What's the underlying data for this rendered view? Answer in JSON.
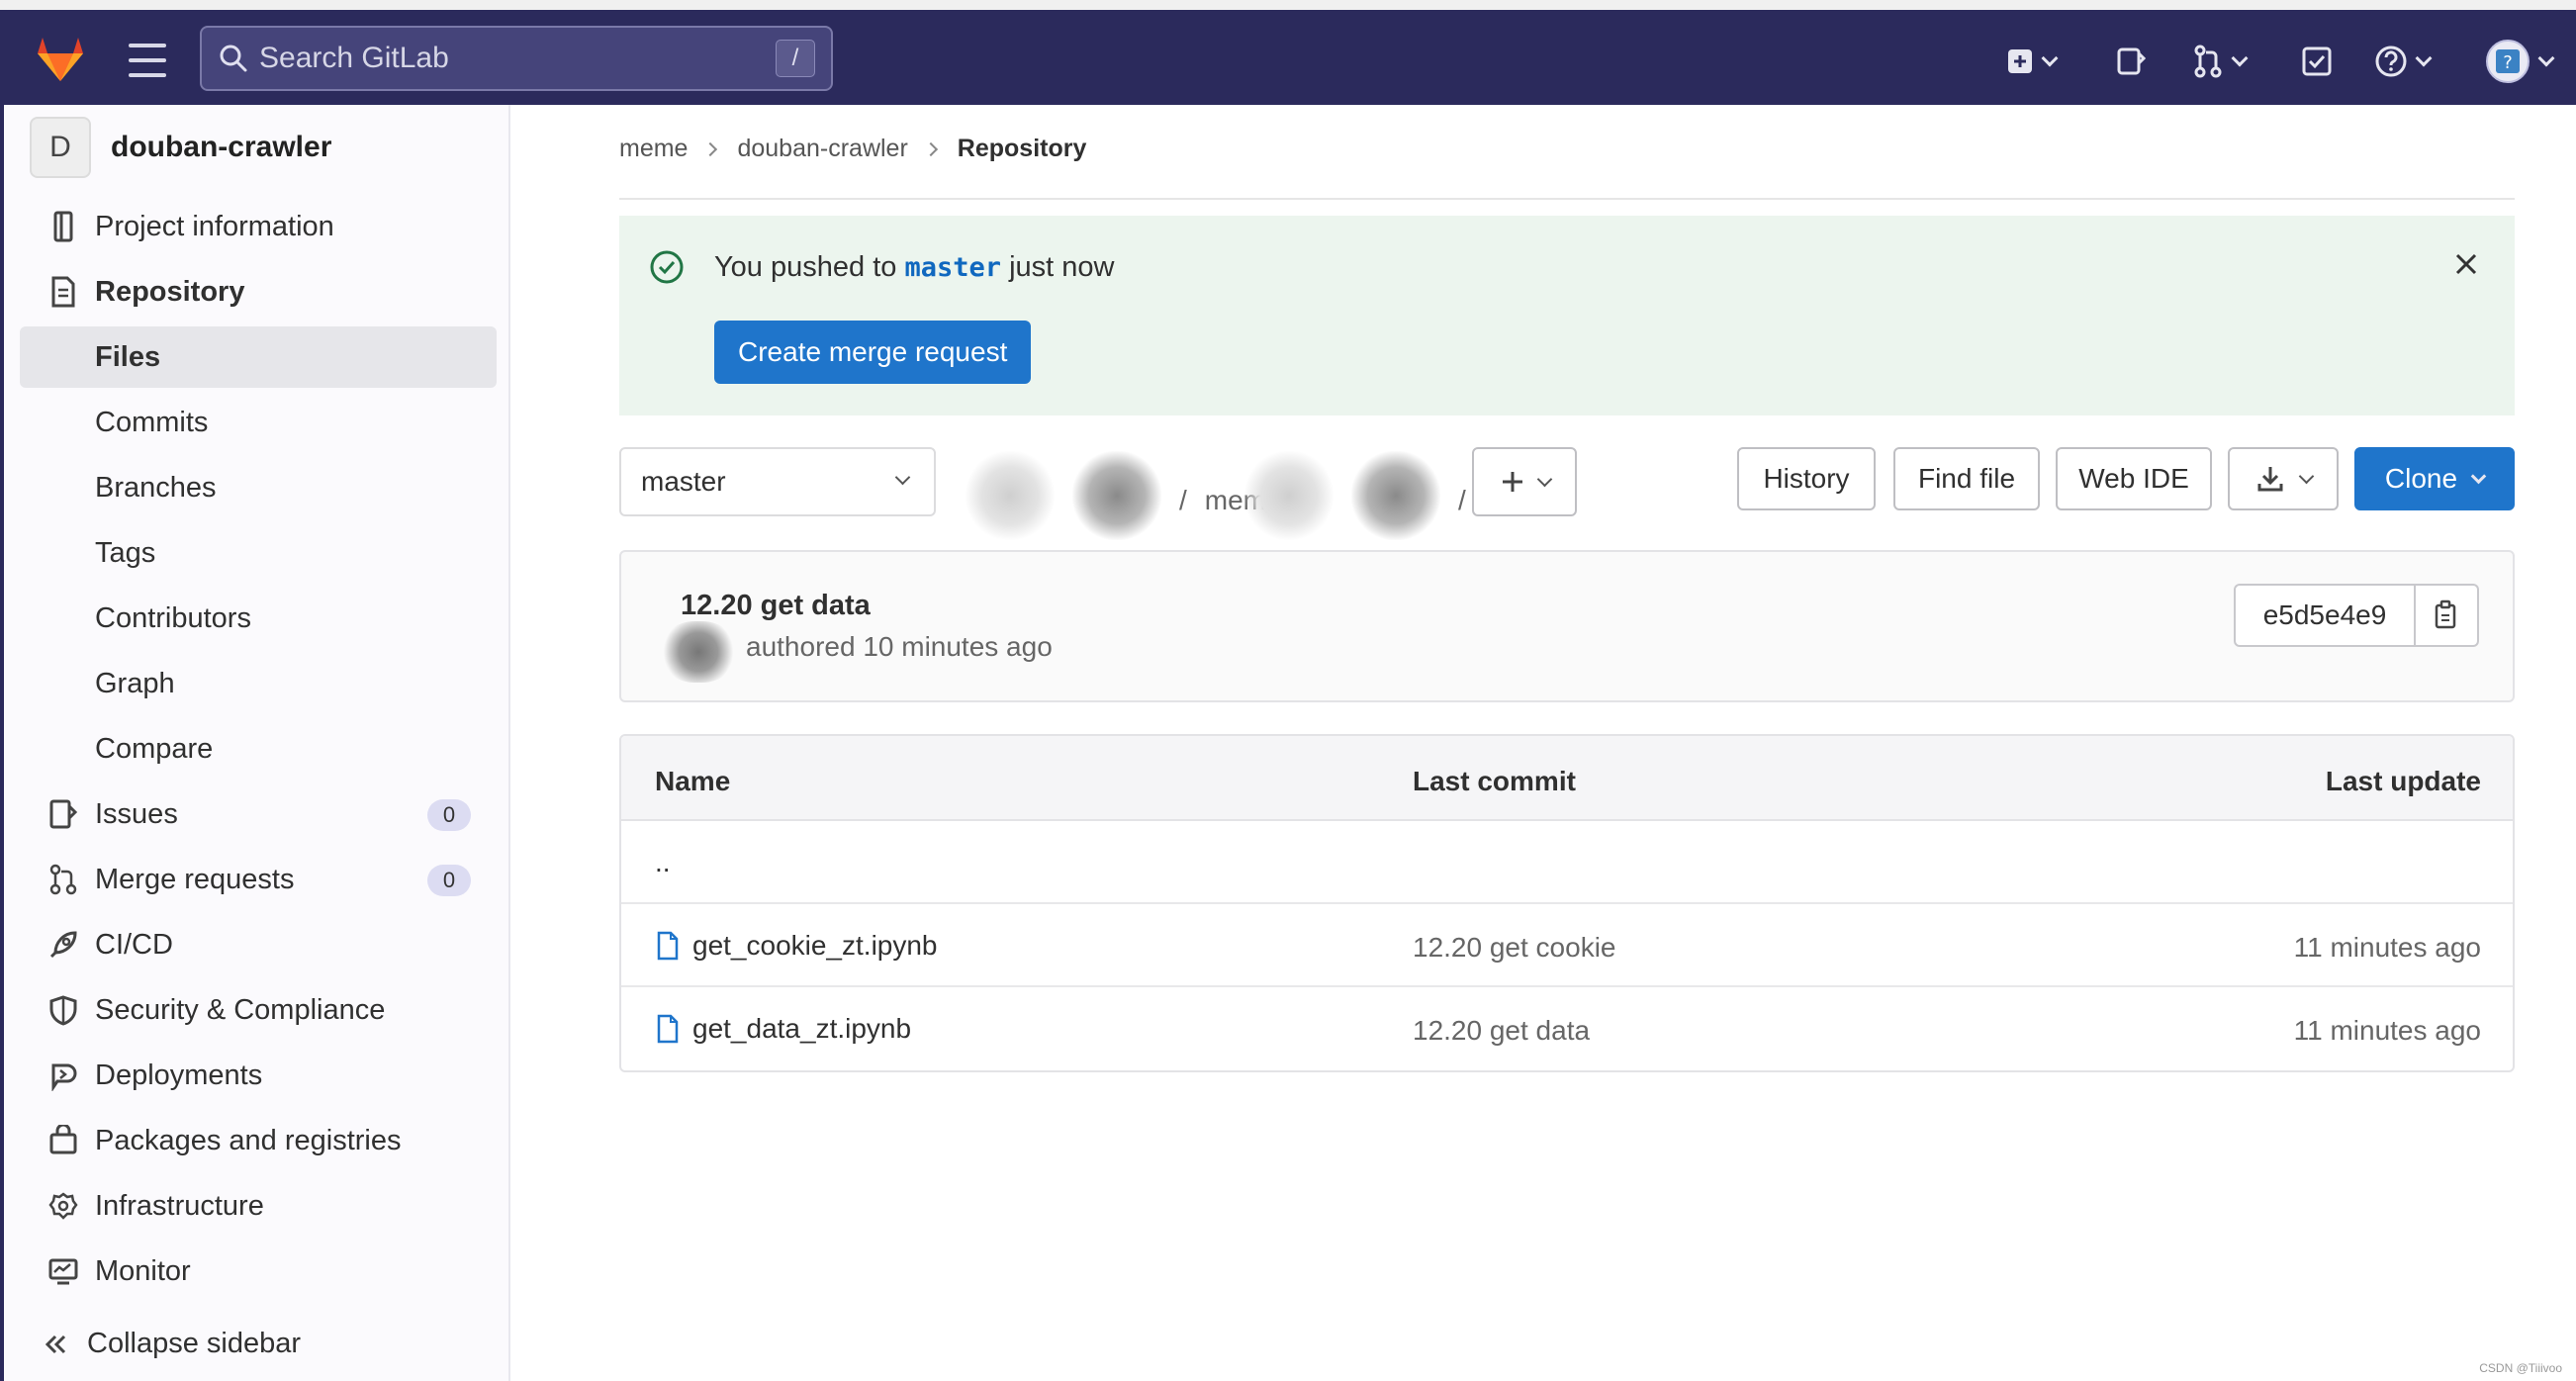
{
  "topbar": {
    "search_placeholder": "Search GitLab",
    "search_shortcut": "/",
    "icons": [
      "gitlab-logo",
      "hamburger-menu-icon",
      "new-item-icon",
      "issues-icon",
      "merge-requests-icon",
      "todos-icon",
      "help-icon",
      "user-avatar"
    ]
  },
  "sidebar": {
    "project_initial": "D",
    "project_name": "douban-crawler",
    "items": [
      {
        "label": "Project information",
        "icon": "info-icon"
      },
      {
        "label": "Repository",
        "icon": "doc-icon"
      },
      {
        "label": "Files"
      },
      {
        "label": "Commits"
      },
      {
        "label": "Branches"
      },
      {
        "label": "Tags"
      },
      {
        "label": "Contributors"
      },
      {
        "label": "Graph"
      },
      {
        "label": "Compare"
      },
      {
        "label": "Issues",
        "icon": "issues-icon",
        "badge": "0"
      },
      {
        "label": "Merge requests",
        "icon": "merge-request-icon",
        "badge": "0"
      },
      {
        "label": "CI/CD",
        "icon": "rocket-icon"
      },
      {
        "label": "Security & Compliance",
        "icon": "shield-icon"
      },
      {
        "label": "Deployments",
        "icon": "deployments-icon"
      },
      {
        "label": "Packages and registries",
        "icon": "package-icon"
      },
      {
        "label": "Infrastructure",
        "icon": "cloud-gear-icon"
      },
      {
        "label": "Monitor",
        "icon": "monitor-icon"
      }
    ],
    "collapse_label": "Collapse sidebar"
  },
  "breadcrumb": [
    "meme",
    "douban-crawler",
    "Repository"
  ],
  "alert": {
    "prefix": "You pushed to",
    "branch": "master",
    "suffix": "just now",
    "button": "Create merge request"
  },
  "toolbar": {
    "branch": "master",
    "path_sep_1": "/",
    "path_part": "mem",
    "path_sep_2": "/",
    "history": "History",
    "find_file": "Find file",
    "web_ide": "Web IDE",
    "clone": "Clone"
  },
  "commit": {
    "title": "12.20 get data",
    "meta": "authored 10 minutes ago",
    "sha": "e5d5e4e9"
  },
  "files": {
    "headers": [
      "Name",
      "Last commit",
      "Last update"
    ],
    "parent": "..",
    "rows": [
      {
        "name": "get_cookie_zt.ipynb",
        "commit": "12.20 get cookie",
        "updated": "11 minutes ago"
      },
      {
        "name": "get_data_zt.ipynb",
        "commit": "12.20 get data",
        "updated": "11 minutes ago"
      }
    ]
  },
  "watermark": "CSDN @Tiiivoo"
}
